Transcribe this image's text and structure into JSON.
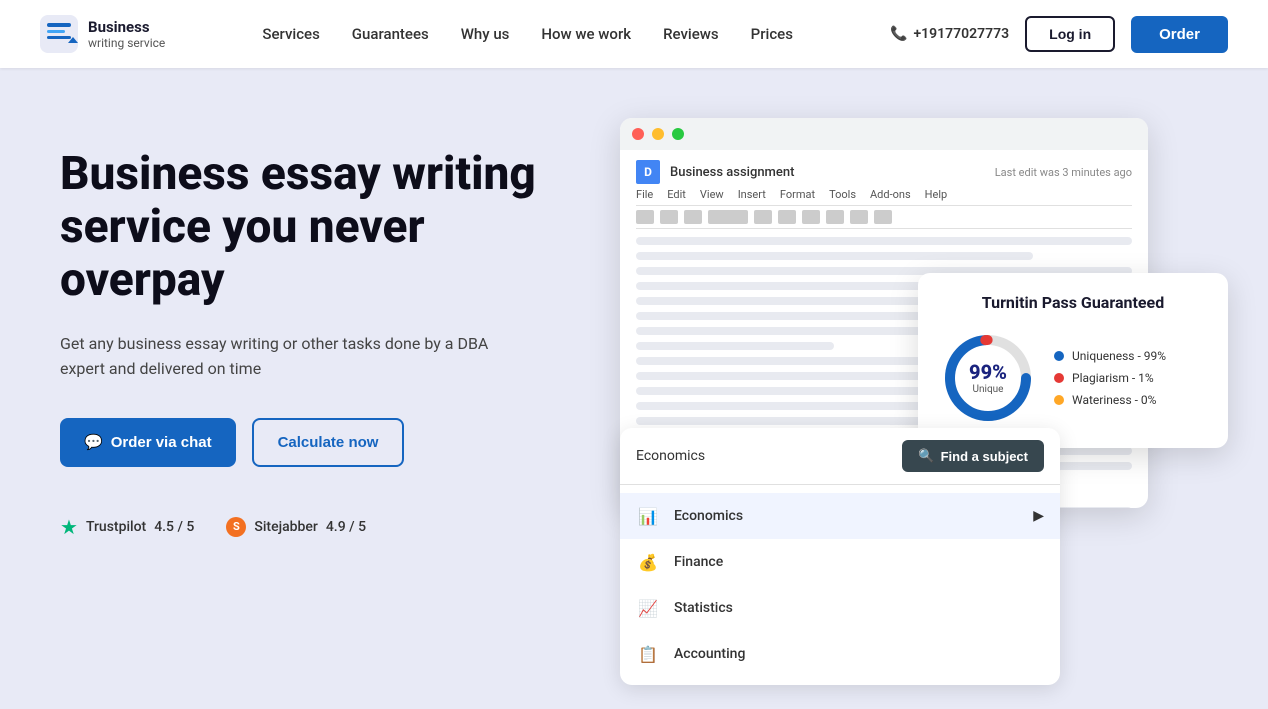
{
  "brand": {
    "name_line1": "Business",
    "name_line2": "writing service",
    "logo_alt": "Business Writing Service Logo"
  },
  "nav": {
    "items": [
      {
        "label": "Services",
        "href": "#"
      },
      {
        "label": "Guarantees",
        "href": "#"
      },
      {
        "label": "Why us",
        "href": "#"
      },
      {
        "label": "How we work",
        "href": "#"
      },
      {
        "label": "Reviews",
        "href": "#"
      },
      {
        "label": "Prices",
        "href": "#"
      }
    ]
  },
  "header": {
    "phone": "+19177027773",
    "login_label": "Log in",
    "order_label": "Order"
  },
  "hero": {
    "title": "Business essay writing service you never overpay",
    "subtitle": "Get any business essay writing or other tasks done by a DBA expert and delivered on time",
    "cta_chat": "Order via chat",
    "cta_calculate": "Calculate now"
  },
  "ratings": {
    "trustpilot_label": "Trustpilot",
    "trustpilot_score": "4.5 / 5",
    "sitejabber_label": "Sitejabber",
    "sitejabber_score": "4.9 / 5"
  },
  "docs_mockup": {
    "title_bar": "Business assignment",
    "saved_text": "Last edit was 3 minutes ago",
    "menu_items": [
      "File",
      "Edit",
      "View",
      "Insert",
      "Format",
      "Tools",
      "Add-ons",
      "Help"
    ]
  },
  "search_card": {
    "subject": "Economics",
    "button_label": "Find a subject",
    "subjects": [
      {
        "label": "Economics",
        "icon": "📊",
        "active": true
      },
      {
        "label": "Finance",
        "icon": "💰",
        "active": false
      },
      {
        "label": "Statistics",
        "icon": "📈",
        "active": false
      },
      {
        "label": "Accounting",
        "icon": "📋",
        "active": false
      }
    ]
  },
  "turnitin": {
    "title": "Turnitin Pass Guaranteed",
    "percent": "99%",
    "unique_label": "Unique",
    "legend": [
      {
        "label": "Uniqueness - 99%",
        "color": "#1565c0"
      },
      {
        "label": "Plagiarism - 1%",
        "color": "#e53935"
      },
      {
        "label": "Wateriness - 0%",
        "color": "#ffa726"
      }
    ]
  }
}
